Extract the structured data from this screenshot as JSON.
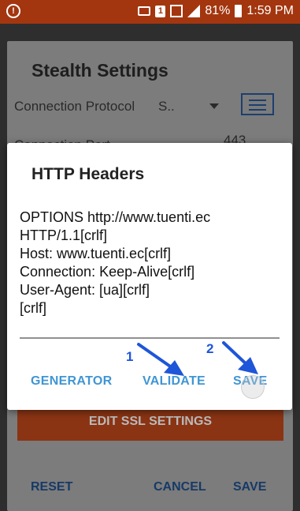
{
  "status_bar": {
    "battery": "81%",
    "time": "1:59 PM",
    "alert_icon": "alert-circle-icon",
    "sim_label": "1",
    "accent_color": "#a3360f"
  },
  "background_screen": {
    "title": "Stealth Settings",
    "protocol_label": "Connection Protocol",
    "protocol_value": "S..",
    "port_label": "Connection Port",
    "port_value": "443",
    "ssl_button": "EDIT SSL SETTINGS",
    "footer": {
      "reset": "RESET",
      "cancel": "CANCEL",
      "save": "SAVE"
    }
  },
  "dialog": {
    "title": "HTTP Headers",
    "header_text": "OPTIONS http://www.tuenti.ec\nHTTP/1.1[crlf]\nHost: www.tuenti.ec[crlf]\nConnection: Keep-Alive[crlf]\nUser-Agent: [ua][crlf]\n[crlf]",
    "buttons": {
      "generator": "GENERATOR",
      "validate": "VALIDATE",
      "save": "SAVE"
    },
    "button_color": "#3f95d4"
  },
  "annotations": {
    "step1": "1",
    "step2": "2",
    "arrow_color": "#1f55d8"
  }
}
